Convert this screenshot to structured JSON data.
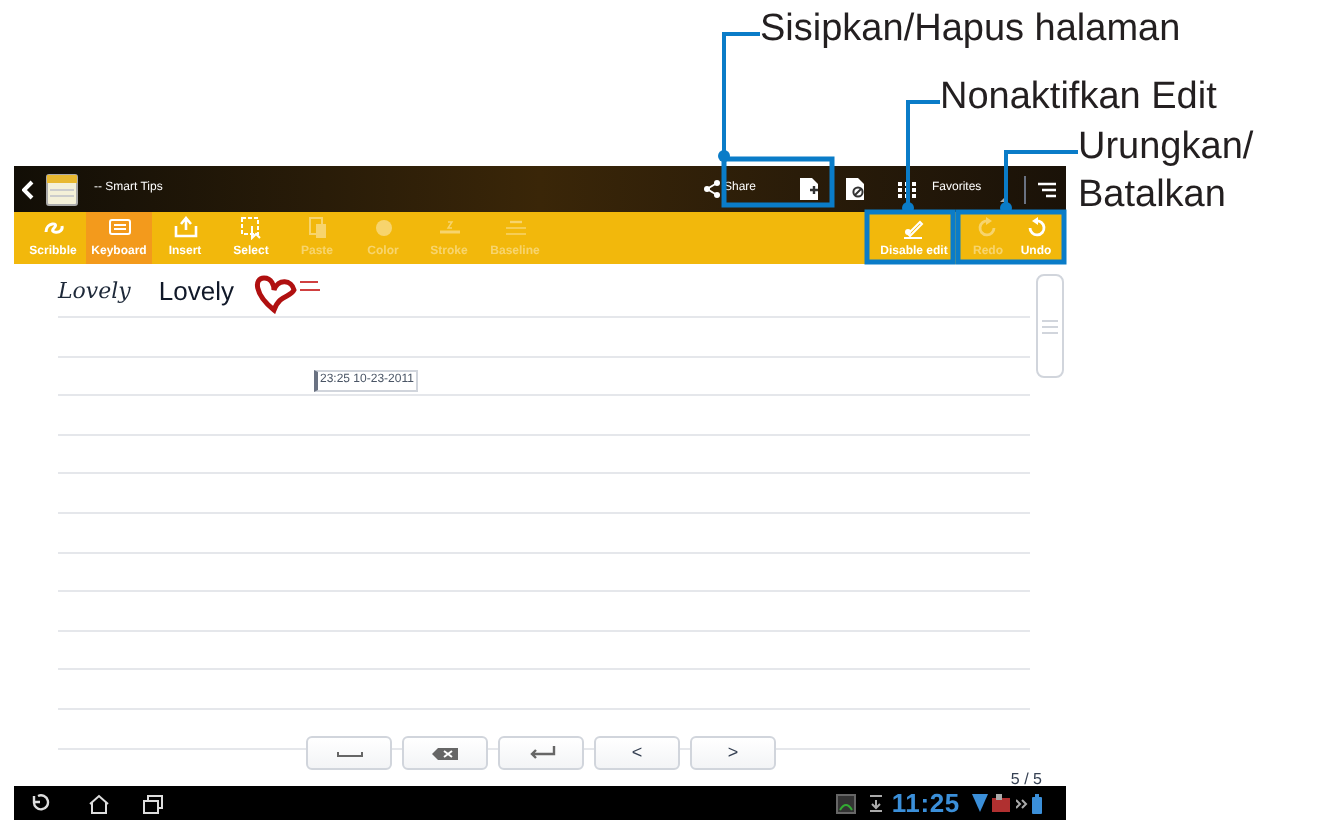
{
  "callouts": [
    {
      "text": "Sisipkan/Hapus halaman"
    },
    {
      "text": "Nonaktifkan Edit"
    },
    {
      "text": "Urungkan/\nBatalkan"
    }
  ],
  "action_bar": {
    "title": "-- Smart Tips",
    "share": "Share",
    "notebook": "Favorites"
  },
  "toolbar": {
    "tools": [
      {
        "kind": "scribble",
        "label": "Scribble",
        "selected": false,
        "disabled": false
      },
      {
        "kind": "keyboard",
        "label": "Keyboard",
        "selected": true,
        "disabled": false
      },
      {
        "kind": "insert",
        "label": "Insert",
        "selected": false,
        "disabled": false
      },
      {
        "kind": "select",
        "label": "Select",
        "selected": false,
        "disabled": false
      },
      {
        "kind": "paste",
        "label": "Paste",
        "selected": false,
        "disabled": true
      },
      {
        "kind": "color",
        "label": "Color",
        "selected": false,
        "disabled": true
      },
      {
        "kind": "stroke",
        "label": "Stroke",
        "selected": false,
        "disabled": true
      },
      {
        "kind": "baseline",
        "label": "Baseline",
        "selected": false,
        "disabled": true
      }
    ],
    "actions": [
      {
        "kind": "disable-edit",
        "label": "Disable edit",
        "disabled": false
      },
      {
        "kind": "redo",
        "label": "Redo",
        "disabled": true
      },
      {
        "kind": "undo",
        "label": "Undo",
        "disabled": false
      }
    ]
  },
  "note": {
    "handwriting": "Lovely",
    "typed": "Lovely",
    "timestamp": "23:25 10-23-2011"
  },
  "keys": [
    {
      "kind": "space"
    },
    {
      "kind": "backspace"
    },
    {
      "kind": "enter"
    },
    {
      "kind": "char",
      "text": "<"
    },
    {
      "kind": "char",
      "text": ">"
    }
  ],
  "page_indicator": "5 / 5",
  "status_bar": {
    "time": "11:25"
  }
}
